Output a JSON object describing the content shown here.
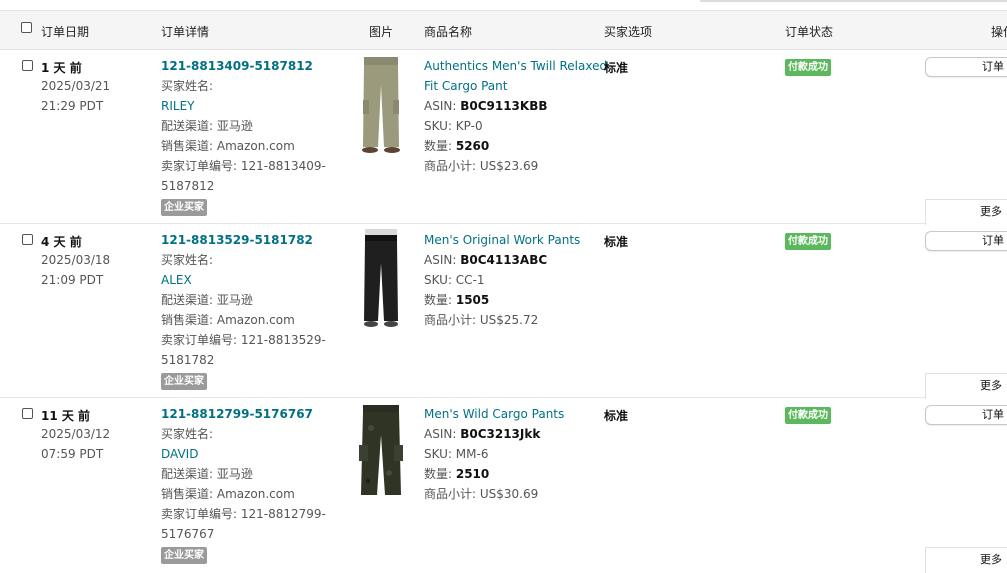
{
  "header": {
    "order_date": "订单日期",
    "order_details": "订单详情",
    "image": "图片",
    "product_name": "商品名称",
    "buyer_options": "买家选项",
    "order_status": "订单状态",
    "actions": "操作"
  },
  "orders": [
    {
      "ago": "1 天 前",
      "date": "2025/03/21",
      "time": "21:29 PDT",
      "order_id": "121-8813409-5187812",
      "buyer_name_label": "买家姓名:",
      "buyer_name": "RILEY",
      "ship_channel": "配送渠道: 亚马逊",
      "sales_channel": "销售渠道: Amazon.com",
      "seller_order_label": "卖家订单编号: 121-8813409-",
      "seller_order_rest": "5187812",
      "business_badge": "企业买家",
      "product_line1": "Authentics Men's Twill Relaxed",
      "product_line2": "Fit Cargo Pant",
      "asin_label": "ASIN: ",
      "asin": "B0C9113KBB",
      "sku": "SKU: KP-0",
      "qty_label": "数量: ",
      "qty": "5260",
      "subtotal": "商品小计: US$23.69",
      "buyer_option": "标准",
      "status": "付款成功",
      "action_btn": "订单",
      "more_btn": "更多"
    },
    {
      "ago": "4 天 前",
      "date": "2025/03/18",
      "time": "21:09 PDT",
      "order_id": "121-8813529-5181782",
      "buyer_name_label": "买家姓名:",
      "buyer_name": "ALEX",
      "ship_channel": "配送渠道: 亚马逊",
      "sales_channel": "销售渠道: Amazon.com",
      "seller_order_label": "卖家订单编号: 121-8813529-",
      "seller_order_rest": "5181782",
      "business_badge": "企业买家",
      "product_line1": "Men's Original Work Pants",
      "product_line2": "",
      "asin_label": "ASIN: ",
      "asin": "B0C4113ABC",
      "sku": "SKU: CC-1",
      "qty_label": "数量: ",
      "qty": "1505",
      "subtotal": "商品小计: US$25.72",
      "buyer_option": "标准",
      "status": "付款成功",
      "action_btn": "订单",
      "more_btn": "更多"
    },
    {
      "ago": "11 天 前",
      "date": "2025/03/12",
      "time": "07:59 PDT",
      "order_id": "121-8812799-5176767",
      "buyer_name_label": "买家姓名:",
      "buyer_name": "DAVID",
      "ship_channel": "配送渠道: 亚马逊",
      "sales_channel": "销售渠道: Amazon.com",
      "seller_order_label": "卖家订单编号: 121-8812799-",
      "seller_order_rest": "5176767",
      "business_badge": "企业买家",
      "product_line1": "Men's Wild Cargo Pants",
      "product_line2": "",
      "asin_label": "ASIN: ",
      "asin": "B0C3213Jkk",
      "sku": "SKU: MM-6",
      "qty_label": "数量: ",
      "qty": "2510",
      "subtotal": "商品小计: US$30.69",
      "buyer_option": "标准",
      "status": "付款成功",
      "action_btn": "订单",
      "more_btn": "更多"
    }
  ],
  "colors": {
    "link": "#007185",
    "status_green": "#5bb85d",
    "badge_gray": "#9a9a9a",
    "pants_khaki": "#9c9a7c",
    "pants_black": "#1f1f1f",
    "pants_olive": "#2f3425"
  },
  "icons": [
    "pants-khaki-image",
    "pants-black-image",
    "pants-camo-image"
  ]
}
